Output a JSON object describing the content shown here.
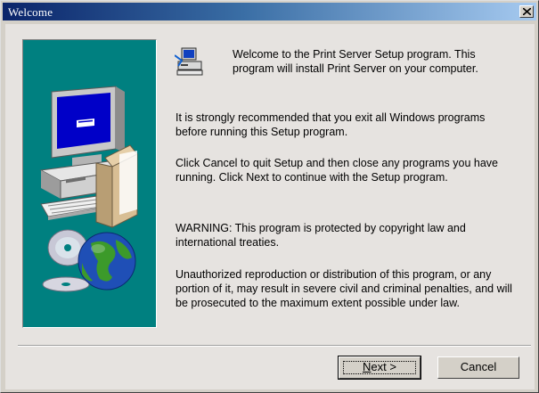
{
  "window": {
    "title": "Welcome",
    "close_label": "×"
  },
  "intro": {
    "line1": "Welcome to the Print Server Setup program.  This",
    "line2": "program will install Print Server on your computer."
  },
  "paragraphs": [
    {
      "lines": [
        "It is strongly recommended that you exit all Windows programs",
        "before running this Setup program."
      ]
    },
    {
      "lines": [
        "Click Cancel to quit Setup and then close any programs you have",
        "running.  Click Next to continue with the Setup program."
      ]
    },
    {
      "lines": [
        "WARNING: This program is protected by copyright law and",
        "international treaties."
      ]
    },
    {
      "lines": [
        "Unauthorized reproduction or distribution of this program, or any",
        "portion of it, may result in severe civil and criminal penalties, and will",
        "be prosecuted to the maximum extent possible under law."
      ]
    }
  ],
  "buttons": {
    "next_mnemonic": "N",
    "next_rest": "ext >",
    "cancel": "Cancel"
  },
  "colors": {
    "side_panel": "#008080",
    "title_start": "#0a246a",
    "title_end": "#a6caf0",
    "dialog_face": "#d4d0c8"
  },
  "icons": {
    "side_illustration": "computer-with-globe-and-discs",
    "app": "setup-computer-icon"
  }
}
